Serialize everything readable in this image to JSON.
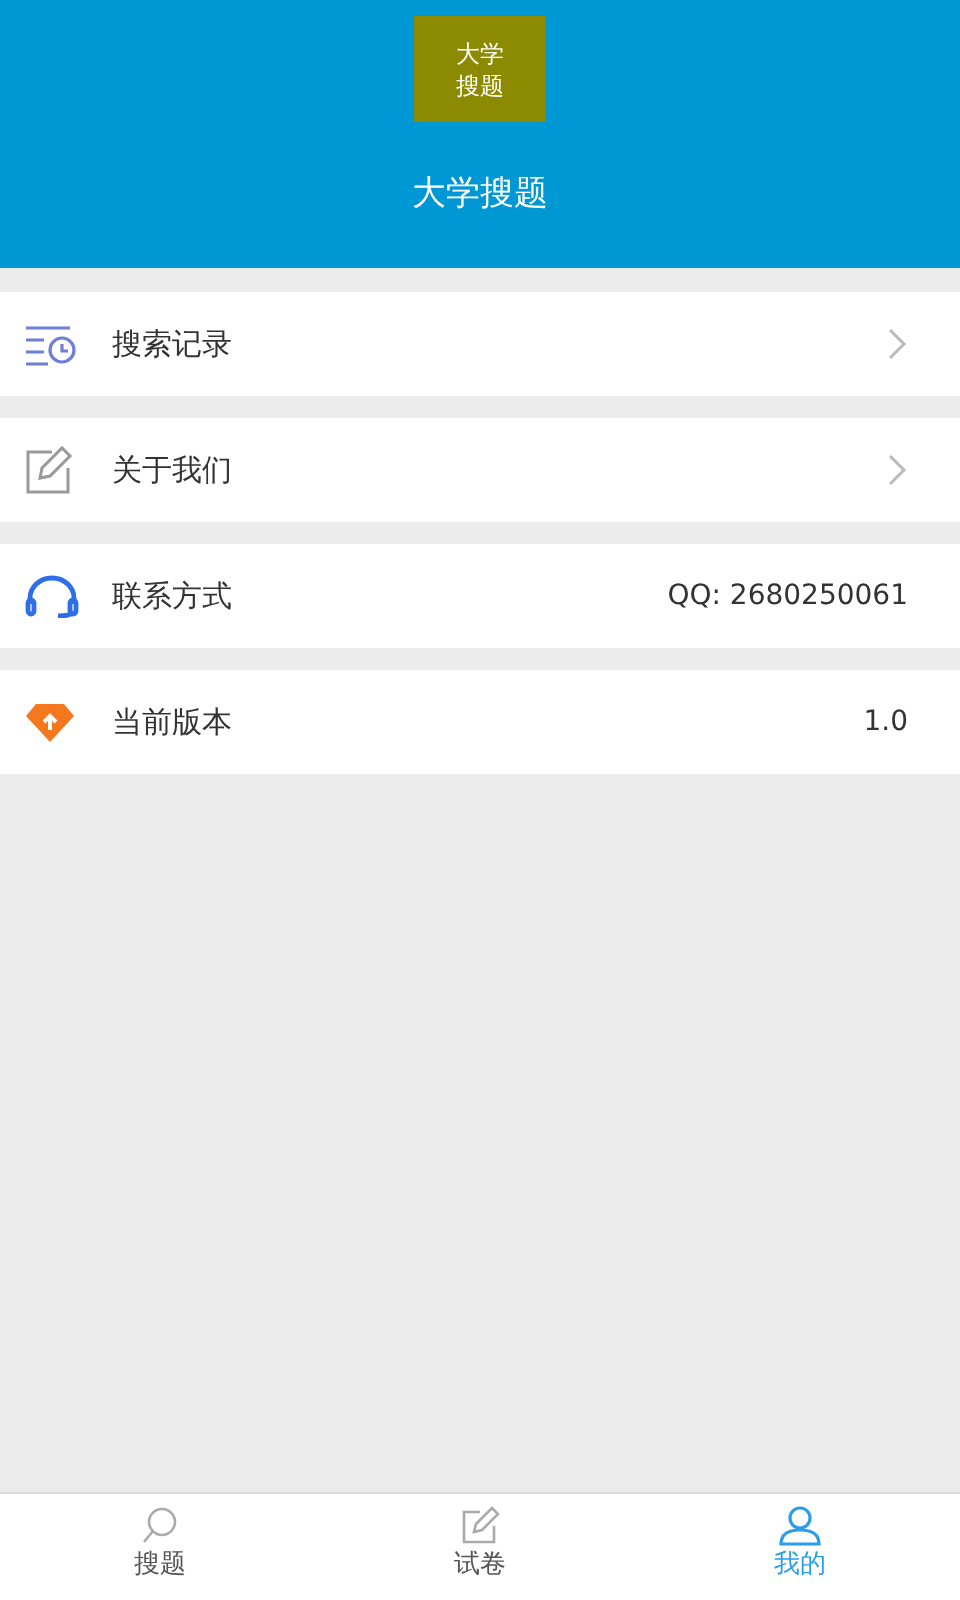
{
  "header": {
    "logo": "大学搜题",
    "title": "大学搜题"
  },
  "menu": [
    {
      "kind": "link",
      "label": "搜索记录"
    },
    {
      "kind": "link",
      "label": "关于我们"
    },
    {
      "kind": "info",
      "label": "联系方式",
      "value": "QQ: 2680250061"
    },
    {
      "kind": "info",
      "label": "当前版本",
      "value": "1.0"
    }
  ],
  "tabs": [
    {
      "label": "搜题",
      "selected": false
    },
    {
      "label": "试卷",
      "selected": false
    },
    {
      "label": "我的",
      "selected": true
    }
  ]
}
